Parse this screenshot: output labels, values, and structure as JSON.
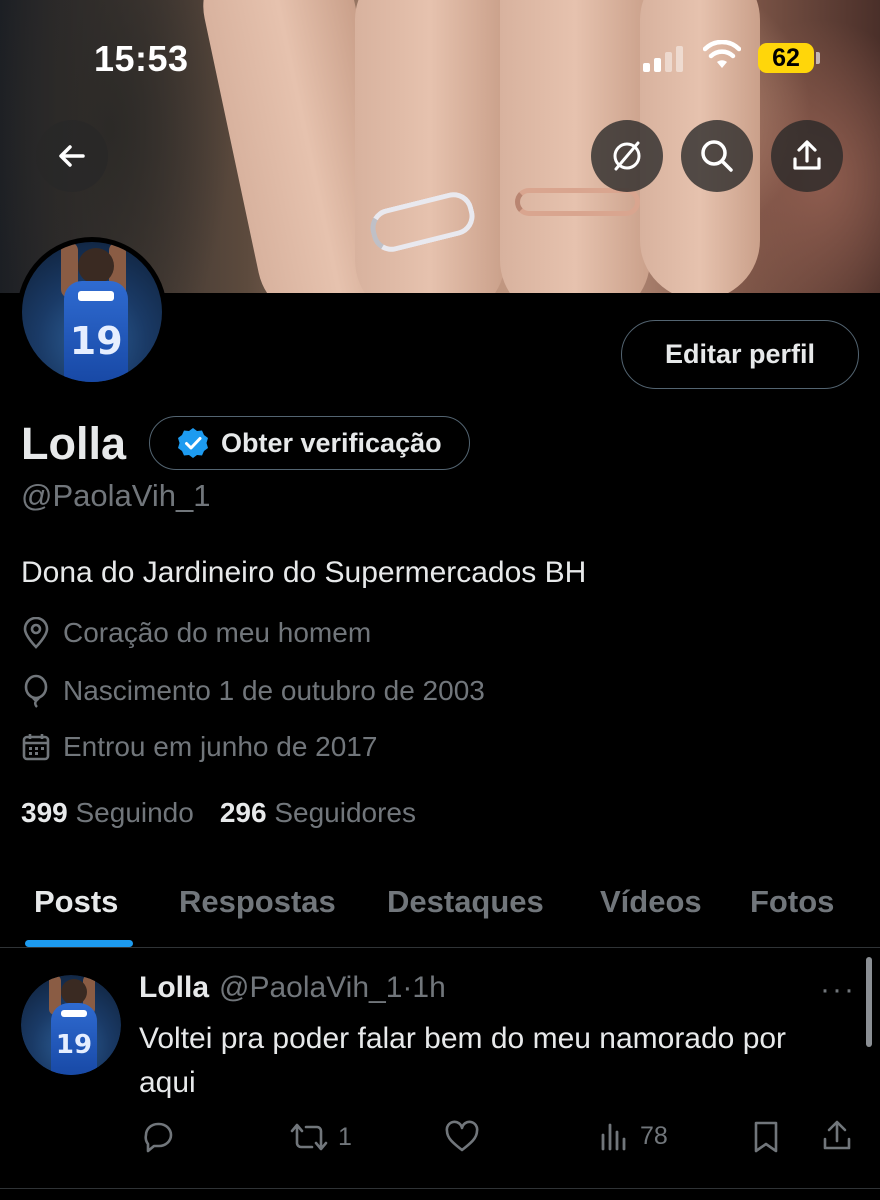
{
  "status_bar": {
    "time": "15:53",
    "battery": "62"
  },
  "banner": {
    "description_icons": [
      "back-arrow-icon",
      "grok-icon",
      "search-icon",
      "share-icon"
    ]
  },
  "profile": {
    "edit_button": "Editar perfil",
    "name": "Lolla",
    "verify_label": "Obter verificação",
    "handle": "@PaolaVih_1",
    "bio": "Dona do Jardineiro do Supermercados BH",
    "location": "Coração do meu homem",
    "birth": "Nascimento 1 de outubro de 2003",
    "joined": "Entrou em junho de 2017",
    "following_count": "399",
    "following_label": "Seguindo",
    "followers_count": "296",
    "followers_label": "Seguidores",
    "avatar_jersey_number": "19"
  },
  "tabs": [
    {
      "label": "Posts",
      "active": true
    },
    {
      "label": "Respostas",
      "active": false
    },
    {
      "label": "Destaques",
      "active": false
    },
    {
      "label": "Vídeos",
      "active": false
    },
    {
      "label": "Fotos",
      "active": false
    }
  ],
  "post": {
    "author": "Lolla",
    "handle": "@PaolaVih_1",
    "separator": "·",
    "time": "1h",
    "more": "···",
    "text": "Voltei pra poder falar bem do meu namorado por aqui",
    "reposts": "1",
    "views": "78"
  },
  "colors": {
    "accent": "#1d9bf0",
    "battery": "#ffd60a",
    "muted": "#71767b",
    "border": "#536471"
  }
}
